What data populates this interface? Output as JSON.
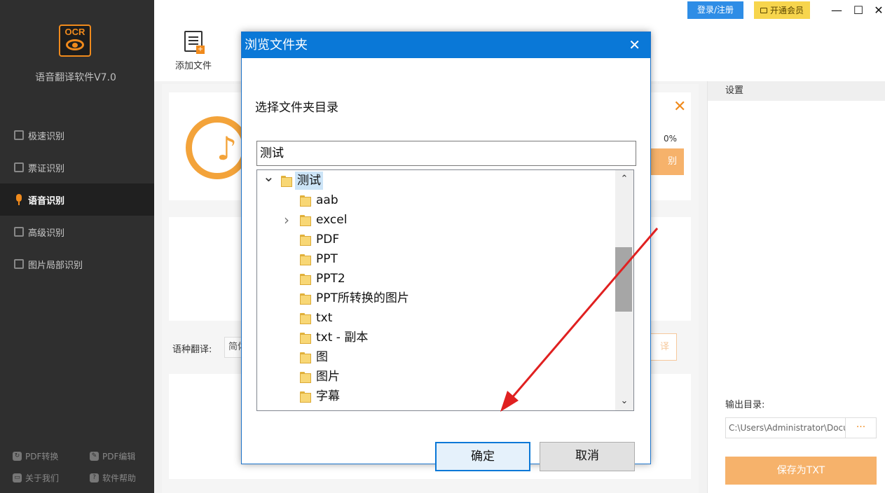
{
  "app": {
    "name": "语音翻译软件V7.0",
    "logo_text": "OCR"
  },
  "sidebar": {
    "items": [
      {
        "label": "极速识别",
        "icon": "fast-recognition-icon"
      },
      {
        "label": "票证识别",
        "icon": "ticket-recognition-icon"
      },
      {
        "label": "语音识别",
        "icon": "microphone-icon",
        "active": true
      },
      {
        "label": "高级识别",
        "icon": "advanced-recognition-icon"
      },
      {
        "label": "图片局部识别",
        "icon": "image-partial-icon"
      }
    ],
    "bottom_links": [
      {
        "label": "PDF转换",
        "icon": "pdf-convert-icon"
      },
      {
        "label": "PDF编辑",
        "icon": "pdf-edit-icon"
      },
      {
        "label": "关于我们",
        "icon": "about-icon"
      },
      {
        "label": "软件帮助",
        "icon": "help-icon"
      }
    ]
  },
  "titlebar": {
    "login_label": "登录/注册",
    "vip_label": "开通会员",
    "minimize": "—",
    "maximize": "☐",
    "close": "✕"
  },
  "toolbar": {
    "add_file_label": "添加文件"
  },
  "main": {
    "progress_text": "0%",
    "progress_value": 0,
    "recognize_btn_partial": "别",
    "lang_label": "语种翻译:",
    "lang_value": "简体",
    "translate_btn_partial": "译"
  },
  "settings": {
    "title": "设置",
    "output_label": "输出目录:",
    "output_path": "C:\\Users\\Administrator\\Docu",
    "browse_label": "···",
    "save_label": "保存为TXT"
  },
  "dialog": {
    "title": "浏览文件夹",
    "close": "✕",
    "description": "选择文件夹目录",
    "path_value": "测试",
    "tree": [
      {
        "label": "测试",
        "level": 0,
        "expander": "expanded",
        "selected": true
      },
      {
        "label": "aab",
        "level": 1,
        "expander": "none"
      },
      {
        "label": "excel",
        "level": 1,
        "expander": "collapsed"
      },
      {
        "label": "PDF",
        "level": 1,
        "expander": "none"
      },
      {
        "label": "PPT",
        "level": 1,
        "expander": "none"
      },
      {
        "label": "PPT2",
        "level": 1,
        "expander": "none"
      },
      {
        "label": "PPT所转换的图片",
        "level": 1,
        "expander": "none"
      },
      {
        "label": "txt",
        "level": 1,
        "expander": "none"
      },
      {
        "label": "txt - 副本",
        "level": 1,
        "expander": "none"
      },
      {
        "label": "图",
        "level": 1,
        "expander": "none"
      },
      {
        "label": "图片",
        "level": 1,
        "expander": "none"
      },
      {
        "label": "字幕",
        "level": 1,
        "expander": "none"
      }
    ],
    "ok_label": "确定",
    "cancel_label": "取消"
  },
  "colors": {
    "accent": "#f08a1c",
    "dialog_title": "#0a78d7",
    "sidebar_bg": "#2f2f2f",
    "annotation_arrow": "#e02020"
  }
}
